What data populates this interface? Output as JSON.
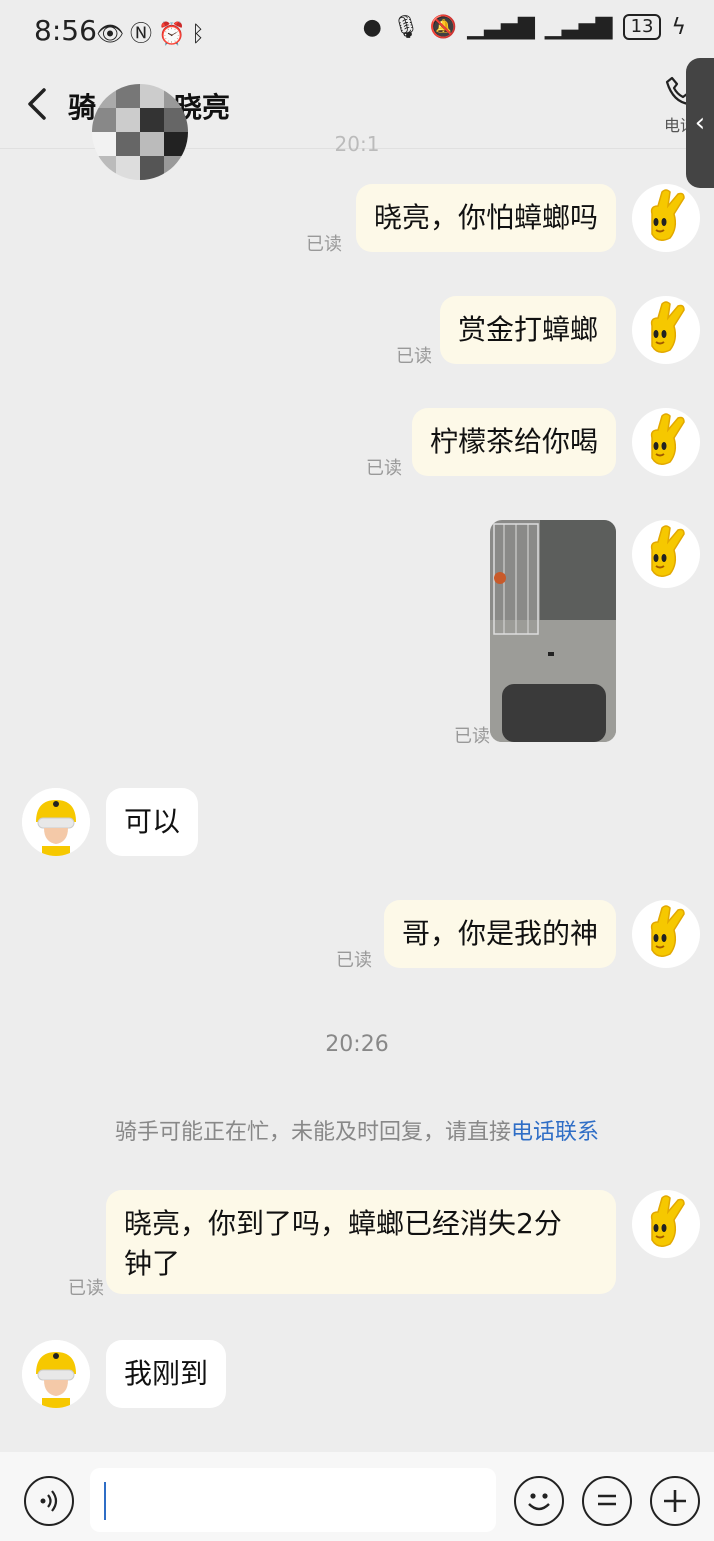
{
  "status": {
    "time": "8:56",
    "battery": "13"
  },
  "header": {
    "title_left": "骑",
    "title_right": "晓亮",
    "call_label": "电话"
  },
  "timestamp_top_fragment": "20:1",
  "messages": [
    {
      "from": "me",
      "text": "晓亮，你怕蟑螂吗",
      "read": "已读"
    },
    {
      "from": "me",
      "text": "赏金打蟑螂",
      "read": "已读"
    },
    {
      "from": "me",
      "text": "柠檬茶给你喝",
      "read": "已读"
    },
    {
      "from": "me",
      "type": "image",
      "read": "已读"
    },
    {
      "from": "rider",
      "text": "可以"
    },
    {
      "from": "me",
      "text": "哥，你是我的神",
      "read": "已读"
    },
    {
      "from": "me",
      "text_line1": "晓亮，你到了吗，蟑螂已经消失2分",
      "text_line2": "钟了",
      "read": "已读"
    },
    {
      "from": "rider",
      "text": "我刚到"
    }
  ],
  "timestamp": "20:26",
  "system_notice": {
    "text": "骑手可能正在忙，未能及时回复，请直接",
    "link": "电话联系"
  },
  "colors": {
    "bg": "#ededed",
    "my_bubble": "#fdf9e8",
    "link": "#2f6ec6"
  },
  "icons": [
    "back-arrow-icon",
    "phone-icon",
    "voice-icon",
    "emoji-icon",
    "more-icon",
    "plus-icon"
  ]
}
